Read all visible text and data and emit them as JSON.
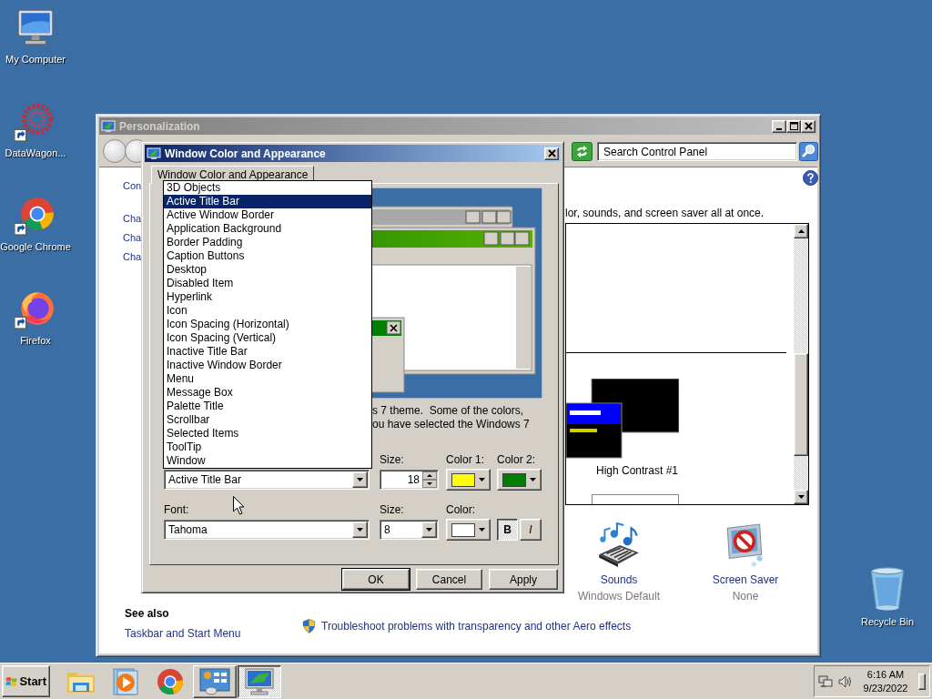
{
  "desktop_icons": [
    {
      "label": "My Computer",
      "kind": "computer"
    },
    {
      "label": "DataWagon...",
      "kind": "datawagon"
    },
    {
      "label": "Google Chrome",
      "kind": "chrome"
    },
    {
      "label": "Firefox",
      "kind": "firefox"
    },
    {
      "label": "Recycle Bin",
      "kind": "recycle"
    }
  ],
  "personalization": {
    "title": "Personalization",
    "search": {
      "placeholder": "Search Control Panel"
    },
    "left_links": [
      "Con",
      "Cha",
      "Cha",
      "Cha"
    ],
    "intro_text": "lor, sounds, and screen saver all at once.",
    "themes": [
      {
        "kind": "high_contrast",
        "label": "High Contrast #1"
      },
      {
        "kind": "white"
      }
    ],
    "settings": [
      {
        "kind": "sounds",
        "label": "Sounds",
        "value": "Windows Default"
      },
      {
        "kind": "screensaver",
        "label": "Screen Saver",
        "value": "None"
      }
    ],
    "see_also": {
      "heading": "See also",
      "links": [
        "Taskbar and Start Menu"
      ]
    },
    "troubleshoot_link": "Troubleshoot problems with transparency and other Aero effects"
  },
  "dialog": {
    "title": "Window Color and Appearance",
    "tabs": [
      {
        "label": "Window Color and Appearance",
        "selected": true
      }
    ],
    "description": [
      "s 7 theme.  Some of the colors,",
      "ou have selected the Windows 7"
    ],
    "item": {
      "value": "Active Title Bar",
      "expanded": true,
      "options": [
        {
          "label": "3D Objects",
          "selected": false
        },
        {
          "label": "Active Title Bar",
          "selected": true
        },
        {
          "label": "Active Window Border",
          "selected": false
        },
        {
          "label": "Application Background",
          "selected": false
        },
        {
          "label": "Border Padding",
          "selected": false
        },
        {
          "label": "Caption Buttons",
          "selected": false
        },
        {
          "label": "Desktop",
          "selected": false
        },
        {
          "label": "Disabled Item",
          "selected": false
        },
        {
          "label": "Hyperlink",
          "selected": false
        },
        {
          "label": "Icon",
          "selected": false
        },
        {
          "label": "Icon Spacing (Horizontal)",
          "selected": false
        },
        {
          "label": "Icon Spacing (Vertical)",
          "selected": false
        },
        {
          "label": "Inactive Title Bar",
          "selected": false
        },
        {
          "label": "Inactive Window Border",
          "selected": false
        },
        {
          "label": "Menu",
          "selected": false
        },
        {
          "label": "Message Box",
          "selected": false
        },
        {
          "label": "Palette Title",
          "selected": false
        },
        {
          "label": "Scrollbar",
          "selected": false
        },
        {
          "label": "Selected Items",
          "selected": false
        },
        {
          "label": "ToolTip",
          "selected": false
        },
        {
          "label": "Window",
          "selected": false
        }
      ]
    },
    "item_size": {
      "label": "Size:",
      "value": "18"
    },
    "color1": {
      "label": "Color 1:",
      "color": "#ffff00"
    },
    "color2": {
      "label": "Color 2:",
      "color": "#008000"
    },
    "font": {
      "label": "Font:",
      "value": "Tahoma"
    },
    "font_size": {
      "label": "Size:",
      "value": "8"
    },
    "font_color": {
      "label": "Color:",
      "color": "#ffffff"
    },
    "bold": {
      "label": "B",
      "on": true
    },
    "italic": {
      "label": "I",
      "on": false
    },
    "buttons": [
      "OK",
      "Cancel",
      "Apply"
    ]
  },
  "taskbar": {
    "start": "Start",
    "apps": [
      {
        "kind": "explorer",
        "running": false,
        "selected": false
      },
      {
        "kind": "media",
        "running": false,
        "selected": false
      },
      {
        "kind": "chrome",
        "running": false,
        "selected": false
      },
      {
        "kind": "control_panel",
        "running": true,
        "selected": false
      },
      {
        "kind": "personalization",
        "running": true,
        "selected": true
      }
    ],
    "clock": {
      "time": "6:16 AM",
      "date": "9/23/2022"
    }
  }
}
